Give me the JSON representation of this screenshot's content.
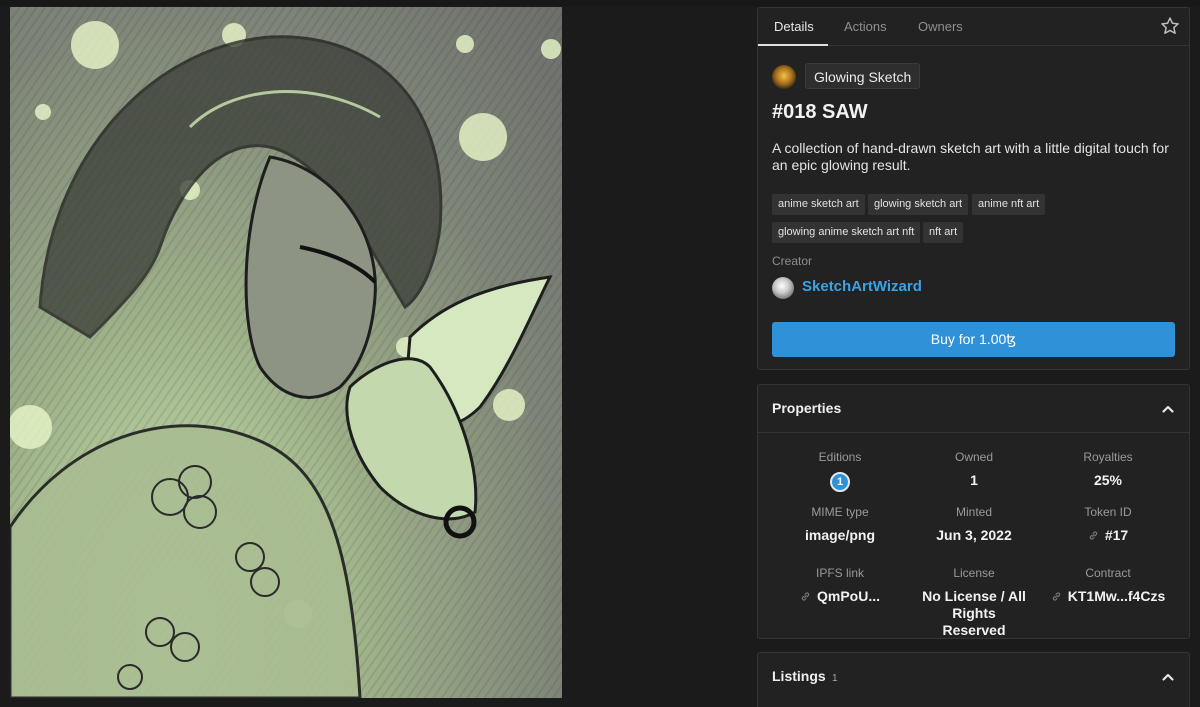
{
  "tabs": [
    {
      "label": "Details"
    },
    {
      "label": "Actions"
    },
    {
      "label": "Owners"
    }
  ],
  "collection": {
    "name": "Glowing Sketch"
  },
  "token": {
    "title": "#018 SAW",
    "description": "A collection of hand-drawn sketch art with a little digital touch for an epic glowing result."
  },
  "tags": [
    "anime sketch art",
    "glowing sketch art",
    "anime nft art",
    "glowing anime sketch art nft",
    "nft art"
  ],
  "creator": {
    "label": "Creator",
    "name": "SketchArtWizard"
  },
  "buy_button": {
    "label": "Buy for 1.00ꜩ"
  },
  "properties": {
    "title": "Properties",
    "editions": {
      "label": "Editions",
      "value": "1"
    },
    "owned": {
      "label": "Owned",
      "value": "1"
    },
    "royalties": {
      "label": "Royalties",
      "value": "25%"
    },
    "mime": {
      "label": "MIME type",
      "value": "image/png"
    },
    "minted": {
      "label": "Minted",
      "value": "Jun 3, 2022"
    },
    "token_id": {
      "label": "Token ID",
      "value": "#17"
    },
    "ipfs": {
      "label": "IPFS link",
      "value": "QmPoU..."
    },
    "license": {
      "label": "License",
      "value": "No License / All Rights Reserved"
    },
    "contract": {
      "label": "Contract",
      "value": "KT1Mw...f4Czs"
    }
  },
  "listings": {
    "title": "Listings",
    "count": "1"
  },
  "colors": {
    "accent": "#2f92d8",
    "link": "#3ba2e6",
    "panel": "#222222",
    "background": "#1b1b1b"
  }
}
